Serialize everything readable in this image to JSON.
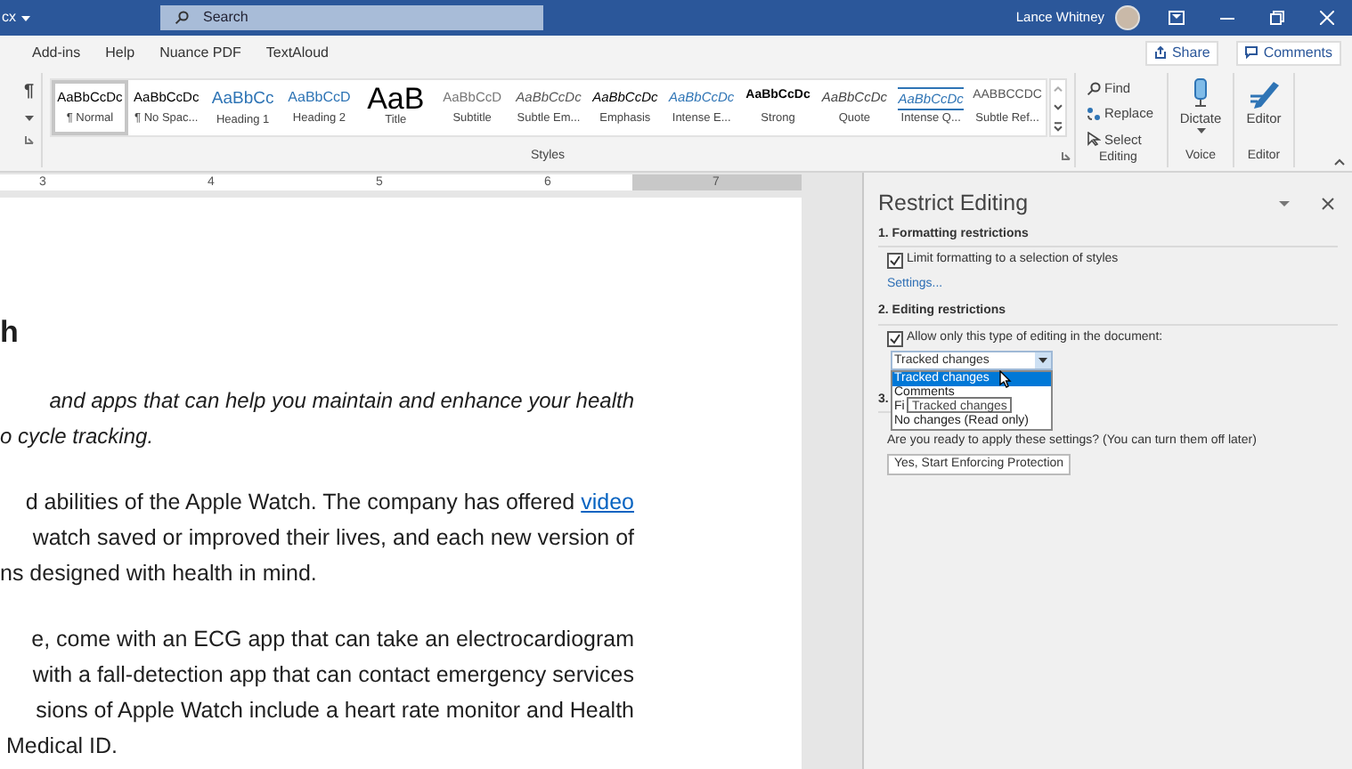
{
  "title_bar": {
    "doc_name": "cx",
    "search": "Search",
    "user": "Lance Whitney"
  },
  "tabs": [
    {
      "label": "Add-ins"
    },
    {
      "label": "Help"
    },
    {
      "label": "Nuance PDF"
    },
    {
      "label": "TextAloud"
    }
  ],
  "show_marks": "¶",
  "share": "Share",
  "comments": "Comments",
  "styles": {
    "label": "Styles",
    "items": [
      {
        "kind": "normal",
        "preview": "AaBbCcDc",
        "label": "¶ Normal",
        "selected": true
      },
      {
        "kind": "normal",
        "preview": "AaBbCcDc",
        "label": "¶ No Spac...",
        "selected": false
      },
      {
        "kind": "heading1",
        "preview": "AaBbCc",
        "label": "Heading 1",
        "selected": false
      },
      {
        "kind": "heading2",
        "preview": "AaBbCcD",
        "label": "Heading 2",
        "selected": false
      },
      {
        "kind": "title",
        "preview": "AaB",
        "label": "Title",
        "selected": false
      },
      {
        "kind": "subtitle",
        "preview": "AaBbCcD",
        "label": "Subtitle",
        "selected": false
      },
      {
        "kind": "subtle-emphasis",
        "preview": "AaBbCcDc",
        "label": "Subtle Em...",
        "selected": false
      },
      {
        "kind": "emphasis",
        "preview": "AaBbCcDc",
        "label": "Emphasis",
        "selected": false
      },
      {
        "kind": "intense-emphasis",
        "preview": "AaBbCcDc",
        "label": "Intense E...",
        "selected": false
      },
      {
        "kind": "strong",
        "preview": "AaBbCcDc",
        "label": "Strong",
        "selected": false
      },
      {
        "kind": "quote",
        "preview": "AaBbCcDc",
        "label": "Quote",
        "selected": false
      },
      {
        "kind": "intense-quote",
        "preview": "AaBbCcDc",
        "label": "Intense Q...",
        "selected": false
      },
      {
        "kind": "subtle-reference",
        "preview": "AABBCCDC",
        "label": "Subtle Ref...",
        "selected": false
      }
    ]
  },
  "editing": {
    "label": "Editing",
    "find": "Find",
    "replace": "Replace",
    "select": "Select"
  },
  "voice": {
    "label": "Voice",
    "dictate": "Dictate"
  },
  "editor": {
    "label": "Editor",
    "button": "Editor"
  },
  "ruler": [
    "3",
    "4",
    "5",
    "6",
    "7"
  ],
  "document": [
    {
      "kind": "heading",
      "lines": [
        {
          "text": "h"
        }
      ]
    },
    {
      "kind": "italic",
      "lines": [
        {
          "text": "and apps that can help you maintain and enhance your health"
        },
        {
          "text": "o cycle tracking."
        }
      ]
    },
    {
      "kind": "body",
      "lines": [
        {
          "text": "d abilities of the Apple Watch. The company has offered ",
          "link": "video"
        },
        {
          "text": "watch saved or improved their lives, and each new version of"
        },
        {
          "text": "ns designed with health in mind."
        }
      ]
    },
    {
      "kind": "body",
      "lines": [
        {
          "text": "e, come with an ECG app that can take an electrocardiogram"
        },
        {
          "text": "with a fall-detection app that can contact emergency services"
        },
        {
          "text": "sions of Apple Watch include a heart rate monitor and Health"
        },
        {
          "text": " Medical ID."
        }
      ]
    }
  ],
  "pane": {
    "title": "Restrict Editing",
    "section1": "1. Formatting restrictions",
    "limit_formatting": {
      "label": "Limit formatting to a selection of styles",
      "checked": true
    },
    "settings": "Settings...",
    "section2": "2. Editing restrictions",
    "allow_only": {
      "label": "Allow only this type of editing in the document:",
      "checked": true
    },
    "combo_value": "Tracked changes",
    "options": [
      {
        "label": "Tracked changes",
        "selected": true
      },
      {
        "label": "Comments",
        "selected": false
      },
      {
        "label": "Fi",
        "selected": false
      },
      {
        "label": "No changes (Read only)",
        "selected": false
      }
    ],
    "tooltip": "Tracked changes",
    "section3": "3.",
    "question": "Are you ready to apply these settings? (You can turn them off later)",
    "enforce_button": "Yes, Start Enforcing Protection"
  }
}
